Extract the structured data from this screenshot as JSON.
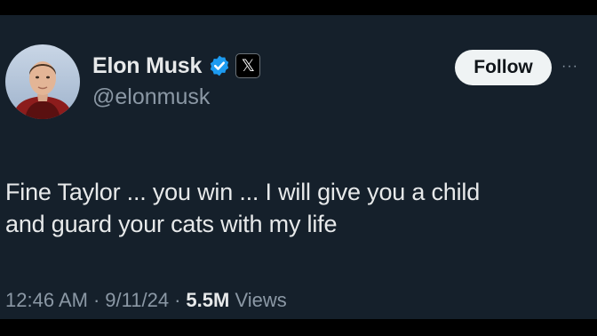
{
  "colors": {
    "background": "#15202b",
    "outer_background": "#000000",
    "primary_text": "#e7e9ea",
    "secondary_text": "#8b98a5",
    "verified_badge": "#1d9bf0",
    "follow_button_bg": "#eff3f4"
  },
  "author": {
    "display_name": "Elon Musk",
    "handle": "@elonmusk",
    "verified_icon": "verified-check-icon",
    "affiliation_icon": "x-logo-icon",
    "affiliation_glyph": "𝕏"
  },
  "actions": {
    "follow_label": "Follow",
    "more_icon": "more-options-icon",
    "more_glyph": "···"
  },
  "tweet": {
    "line1": "Fine Taylor ... you win ... I will give you a child",
    "line2": "and guard your cats with my life"
  },
  "meta": {
    "time": "12:46 AM",
    "separator": "·",
    "date": "9/11/24",
    "views_count": "5.5M",
    "views_label": "Views"
  }
}
